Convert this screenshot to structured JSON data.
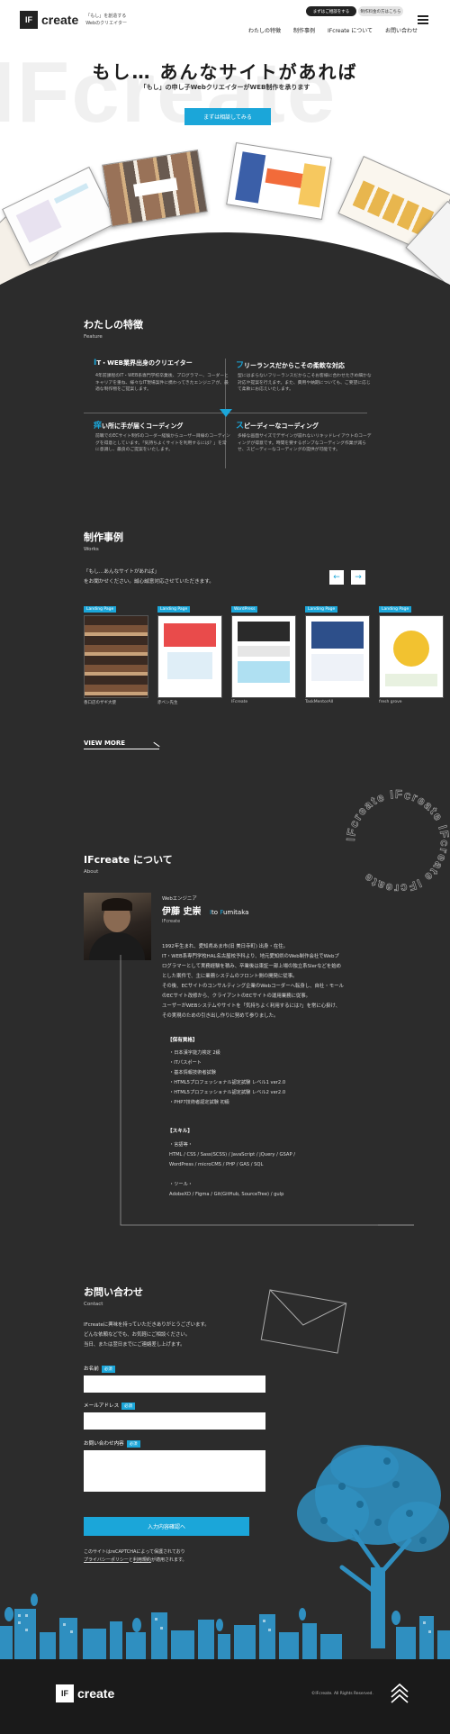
{
  "header": {
    "logo_mark": "IF",
    "logo_word": "create",
    "logo_tagline_1": "「もし」を創造する",
    "logo_tagline_2": "Webのクリエイター",
    "btn_consult": "まずはご相談をする",
    "btn_price": "制作料金の方はこちら",
    "nav": [
      "わたしの特徴",
      "制作事例",
      "IFcreate について",
      "お問い合わせ"
    ]
  },
  "hero": {
    "bg_word": "IFcreate",
    "title": "もし… あんなサイトがあれば",
    "subtitle": "「もし」の申し子WebクリエイターがWEB制作を承ります",
    "cta": "まずは相談してみる"
  },
  "feature": {
    "title": "わたしの特徴",
    "en": "Feature",
    "items": [
      {
        "head_first": "I",
        "head_rest": "T・WEB業界出身のクリエイター",
        "body": "4年前課程のIT・WEB系専門学校卒業後、プログラマー、コーダーとキャリアを重ね、様々なIT現場案件に携わってきたエンジニアが、最適な制作物をご提案します。"
      },
      {
        "head_first": "フ",
        "head_rest": "リーランスだからこその柔軟な対応",
        "body": "型にはまらないフリーランスだからこそお客様に合わせたきめ細かな対応や提案を行えます。また、費用や納期についても、ご要望に応じて柔軟にお応えいたします。"
      },
      {
        "head_first": "痒",
        "head_rest": "い所に手が届くコーディング",
        "body": "前職でのECサイト制作のコーダー経験からユーザー目線のコーディングを得意としています。「気持ちよくサイトを利用するには？」を常に意識し、最良のご提案をいたします。"
      },
      {
        "head_first": "ス",
        "head_rest": "ピーディーなコーディング",
        "body": "多様な画面サイズでデザインが崩れないリキッドレイアウトのコーディングが得意です。時間を要するポンプなコーディング作業が減らせ、スピーディーなコーディングの提供が可能です。"
      }
    ]
  },
  "works": {
    "title": "制作事例",
    "en": "Works",
    "desc_1": "「もし…あんなサイトがあれば」",
    "desc_2": "をお聞かせください。誠心誠意対応させていただきます。",
    "prev": "←",
    "next": "→",
    "cards": [
      {
        "tag": "Landing Page",
        "name": "香口店のザギ大使"
      },
      {
        "tag": "Landing Page",
        "name": "赤ペン先生"
      },
      {
        "tag": "WordPress",
        "name": "IFcreate"
      },
      {
        "tag": "Landing Page",
        "name": "TaskMentorAll"
      },
      {
        "tag": "Landing Page",
        "name": "fresh grove"
      }
    ],
    "view_more": "VIEW MORE"
  },
  "about": {
    "title": "IFcreate について",
    "en": "About",
    "circle_text": "IFcreate IFcreate IFcreate IFcreate ",
    "role": "Webエンジニア",
    "name_jp": "伊藤 史崇",
    "name_en_first_i": "I",
    "name_en_i_rest": "to ",
    "name_en_first_f": "F",
    "name_en_f_rest": "umitaka",
    "company": "IFcreate",
    "bio": [
      "1992年生まれ、愛知県あま市(旧 美日寺町) 出身・在住。",
      "IT・WEB系専門学校HAL名古屋校予科より、地元愛知県のWeb制作会社でWebプ",
      "ログラマーとして実務経験を積み、卒業後は東証一部上場の独立系SIerなどを始め",
      "とした案件で、主に業務システムのフロント側の開発に従事。",
      "その後、ECサイトのコンサルティング企業のWebコーダーへ転身し、自社・モール",
      "のECサイト改修から、クライアントのECサイトの運用業務に従事。",
      "ユーザーがWEBシステムやサイトを「気持ちよく利用するには?」を常に心掛け、",
      "その実現のための引き出し作りに努めて参りました。"
    ],
    "qual_head": "【保有資格】",
    "quals": [
      "・日本漢字能力検定 2級",
      "・ITパスポート",
      "・基本情報技術者試験",
      "・HTML5プロフェッショナル認定試験 レベル1 ver2.0",
      "・HTML5プロフェッショナル認定試験 レベル2 ver2.0",
      "・PHP7技術者認定試験 初級"
    ],
    "skill_head": "【スキル】",
    "skills": [
      "・言語等・",
      "HTML / CSS / Sass(SCSS) / JavaScript / jQuery / GSAP /",
      "WordPress / microCMS / PHP / GAS / SQL",
      "",
      "・ツール・",
      "AdobeXD / Figma / Git(GitHub, SourceTree) / gulp"
    ]
  },
  "contact": {
    "title": "お問い合わせ",
    "en": "Contact",
    "intro": [
      "IFcreateに興味を持っていただきありがとうございます。",
      "どんな依頼などでも、お気軽にご相談ください。",
      "当日、または翌日までにご連絡差し上げます。"
    ],
    "name_label": "お名前",
    "email_label": "メールアドレス",
    "message_label": "お問い合わせ内容",
    "required": "必須",
    "submit": "入力内容確認へ",
    "recaptcha_1": "このサイトはreCAPTCHAによって保護されており",
    "recaptcha_privacy": "プライバシーポリシー",
    "recaptcha_and": "と",
    "recaptcha_terms": "利用規約",
    "recaptcha_2": "が適用されます。"
  },
  "footer": {
    "logo_mark": "IF",
    "logo_word": "create",
    "copyright": "©IFcreate. All Rights Reserved."
  },
  "colors": {
    "accent": "#1ba6d9",
    "dark_bg": "#2c2c2c",
    "footer_bg": "#1a1a1a",
    "tree": "#2f8fc0"
  }
}
